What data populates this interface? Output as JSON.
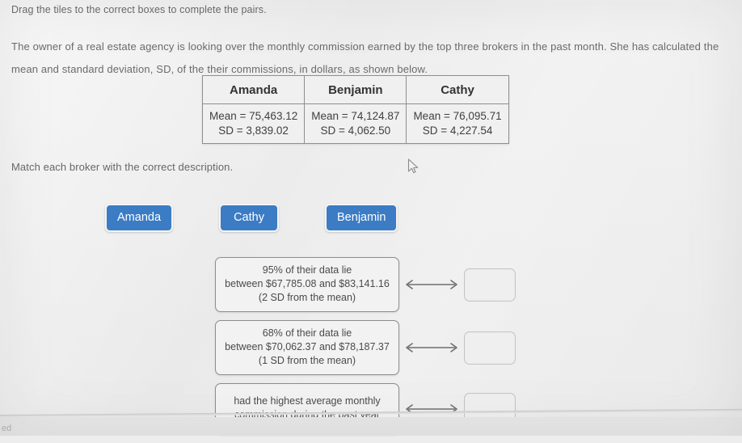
{
  "instructions": {
    "drag_tiles": "Drag the tiles to the correct boxes to complete the pairs.",
    "scenario": "The owner of a real estate agency is looking over the monthly commission earned by the top three brokers in the past month. She has calculated the mean and standard deviation, SD, of the their commissions, in dollars, as shown below.",
    "match": "Match each broker with the correct description."
  },
  "table": {
    "headers": [
      "Amanda",
      "Benjamin",
      "Cathy"
    ],
    "rows": [
      {
        "mean": "Mean = 75,463.12",
        "sd": "SD = 3,839.02"
      },
      {
        "mean": "Mean = 74,124.87",
        "sd": "SD = 4,062.50"
      },
      {
        "mean": "Mean = 76,095.71",
        "sd": "SD = 4,227.54"
      }
    ]
  },
  "tiles": [
    {
      "label": "Amanda"
    },
    {
      "label": "Cathy"
    },
    {
      "label": "Benjamin"
    }
  ],
  "match_rows": [
    {
      "line1": "95% of their data lie",
      "line2": "between $67,785.08 and $83,141.16",
      "line3": "(2 SD from the mean)",
      "answer": ""
    },
    {
      "line1": "68% of their data lie",
      "line2": "between $70,062.37 and $78,187.37",
      "line3": "(1 SD from the mean)",
      "answer": ""
    },
    {
      "line1": "had the highest average monthly",
      "line2": "commission during the past year",
      "line3": "",
      "answer": ""
    }
  ],
  "bottom": {
    "fragment": "ed"
  },
  "colors": {
    "tile_blue": "#3b7cc4",
    "background": "#ececec",
    "text": "#5c5c5c",
    "table_border": "#8e8e8e"
  }
}
